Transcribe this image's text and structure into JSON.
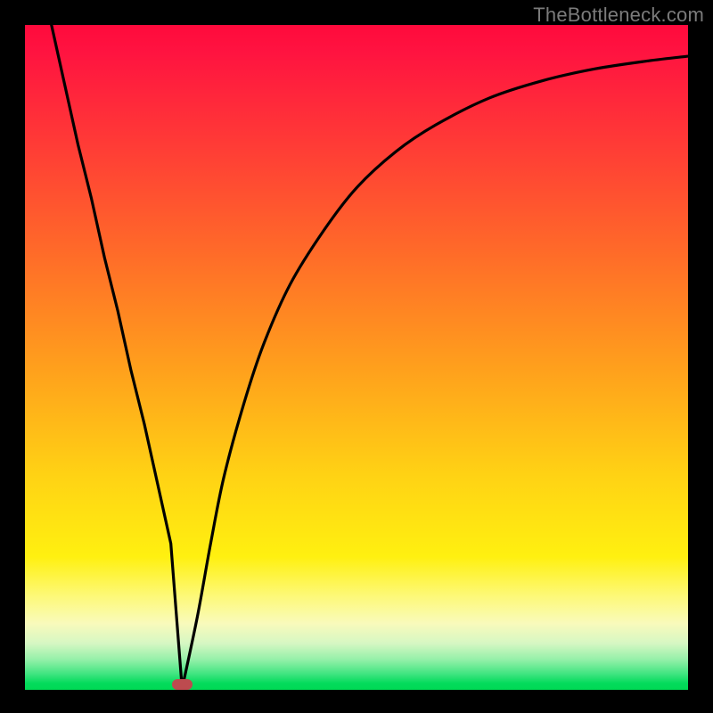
{
  "credit": "TheBottleneck.com",
  "marker": {
    "x_frac": 0.237,
    "y_frac": 0.992
  },
  "chart_data": {
    "type": "line",
    "title": "",
    "xlabel": "",
    "ylabel": "",
    "xlim": [
      0,
      100
    ],
    "ylim": [
      0,
      100
    ],
    "series": [
      {
        "name": "bottleneck-curve",
        "x": [
          4,
          6,
          8,
          10,
          12,
          14,
          16,
          18,
          20,
          22,
          23.7,
          26,
          28,
          30,
          33,
          36,
          40,
          45,
          50,
          56,
          62,
          70,
          78,
          86,
          94,
          100
        ],
        "y": [
          100,
          91,
          82,
          74,
          65,
          57,
          48,
          40,
          31,
          22,
          0.2,
          11,
          22,
          32,
          43,
          52,
          61,
          69,
          75.5,
          81,
          85,
          89,
          91.6,
          93.4,
          94.6,
          95.3
        ]
      }
    ],
    "annotations": [
      {
        "name": "optimal-marker",
        "x": 23.7,
        "y": 0.8
      }
    ],
    "background": "heat-gradient red→yellow→green (vertical)"
  }
}
